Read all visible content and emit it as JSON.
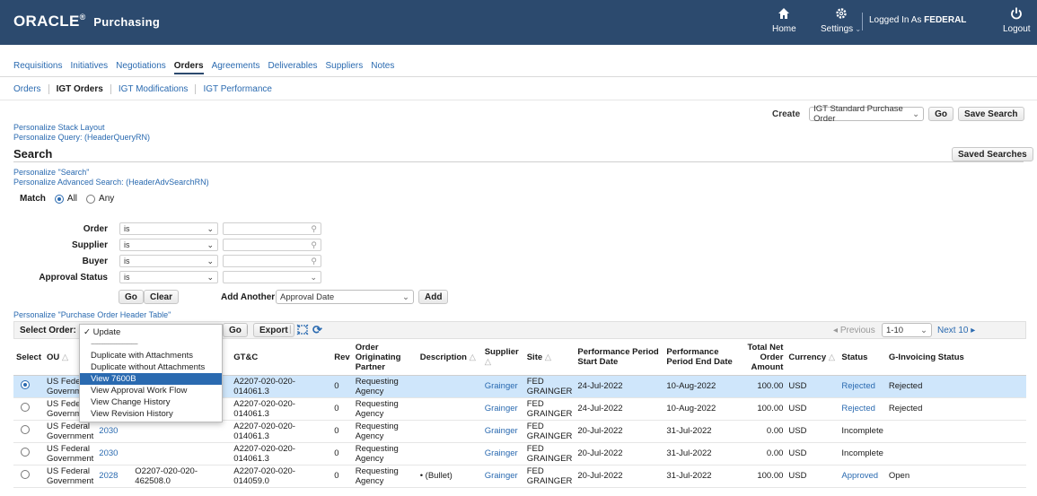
{
  "header": {
    "brand": "ORACLE",
    "app": "Purchasing",
    "home_label": "Home",
    "settings_label": "Settings",
    "logged_prefix": "Logged In As",
    "user": "FEDERAL",
    "logout_label": "Logout"
  },
  "tabs": [
    "Requisitions",
    "Initiatives",
    "Negotiations",
    "Orders",
    "Agreements",
    "Deliverables",
    "Suppliers",
    "Notes"
  ],
  "active_tab": "Orders",
  "subtabs": [
    "Orders",
    "IGT Orders",
    "IGT Modifications",
    "IGT Performance"
  ],
  "active_subtab": "IGT Orders",
  "create": {
    "label": "Create",
    "value": "IGT Standard Purchase Order",
    "go": "Go",
    "save_search": "Save Search"
  },
  "personalize": {
    "stack": "Personalize Stack Layout",
    "query": "Personalize Query: (HeaderQueryRN)",
    "search": "Personalize \"Search\"",
    "adv": "Personalize Advanced Search: (HeaderAdvSearchRN)",
    "table": "Personalize \"Purchase Order Header Table\""
  },
  "search": {
    "title": "Search",
    "saved_searches": "Saved Searches",
    "match_label": "Match",
    "match_all": "All",
    "match_any": "Any",
    "criteria": [
      {
        "label": "Order",
        "op": "is"
      },
      {
        "label": "Supplier",
        "op": "is"
      },
      {
        "label": "Buyer",
        "op": "is"
      },
      {
        "label": "Approval Status",
        "op": "is"
      }
    ],
    "go": "Go",
    "clear": "Clear",
    "add_another_label": "Add Another",
    "add_another_value": "Approval Date",
    "add": "Add"
  },
  "table_toolbar": {
    "select_order": "Select Order:",
    "go": "Go",
    "export": "Export",
    "previous": "Previous",
    "range": "1-10",
    "next": "Next 10"
  },
  "menu": {
    "items": [
      "Update",
      "------------------------",
      "Duplicate with Attachments",
      "Duplicate without Attachments",
      "View 7600B",
      "View Approval Work Flow",
      "View Change History",
      "View Revision History"
    ],
    "highlighted": "View 7600B"
  },
  "table": {
    "headers": {
      "select": "Select",
      "ou": "OU",
      "gtc": "GT&C",
      "rev": "Rev",
      "agency": "Order Originating Partner",
      "description": "Description",
      "supplier": "Supplier",
      "site": "Site",
      "start": "Performance Period Start Date",
      "end": "Performance Period End Date",
      "amount": "Total Net Order Amount",
      "currency": "Currency",
      "status": "Status",
      "ginv": "G-Invoicing Status"
    },
    "rows": [
      {
        "ou": "US Federal Government",
        "order": "",
        "ref": "",
        "gtc": "A2207-020-020-014061.3",
        "rev": "0",
        "agency": "Requesting Agency",
        "desc": "",
        "supplier": "Grainger",
        "site": "FED GRAINGER",
        "start": "24-Jul-2022",
        "end": "10-Aug-2022",
        "amount": "100.00",
        "currency": "USD",
        "status": "Rejected",
        "status_link": true,
        "ginv": "Rejected",
        "selected": true
      },
      {
        "ou": "US Federal Government",
        "order": "",
        "ref": "",
        "gtc": "A2207-020-020-014061.3",
        "rev": "0",
        "agency": "Requesting Agency",
        "desc": "",
        "supplier": "Grainger",
        "site": "FED GRAINGER",
        "start": "24-Jul-2022",
        "end": "10-Aug-2022",
        "amount": "100.00",
        "currency": "USD",
        "status": "Rejected",
        "status_link": true,
        "ginv": "Rejected",
        "selected": false
      },
      {
        "ou": "US Federal Government",
        "order": "2030",
        "ref": "",
        "gtc": "A2207-020-020-014061.3",
        "rev": "0",
        "agency": "Requesting Agency",
        "desc": "",
        "supplier": "Grainger",
        "site": "FED GRAINGER",
        "start": "20-Jul-2022",
        "end": "31-Jul-2022",
        "amount": "0.00",
        "currency": "USD",
        "status": "Incomplete",
        "status_link": false,
        "ginv": "",
        "selected": false
      },
      {
        "ou": "US Federal Government",
        "order": "2030",
        "ref": "",
        "gtc": "A2207-020-020-014061.3",
        "rev": "0",
        "agency": "Requesting Agency",
        "desc": "",
        "supplier": "Grainger",
        "site": "FED GRAINGER",
        "start": "20-Jul-2022",
        "end": "31-Jul-2022",
        "amount": "0.00",
        "currency": "USD",
        "status": "Incomplete",
        "status_link": false,
        "ginv": "",
        "selected": false
      },
      {
        "ou": "US Federal Government",
        "order": "2028",
        "ref": "O2207-020-020-462508.0",
        "gtc": "A2207-020-020-014059.0",
        "rev": "0",
        "agency": "Requesting Agency",
        "desc": "• (Bullet)",
        "supplier": "Grainger",
        "site": "FED GRAINGER",
        "start": "20-Jul-2022",
        "end": "31-Jul-2022",
        "amount": "100.00",
        "currency": "USD",
        "status": "Approved",
        "status_link": true,
        "ginv": "Open",
        "selected": false
      }
    ]
  },
  "colors": {
    "header_bg": "#2c4a6e",
    "link": "#2a6ab0",
    "selected_row": "#cfe6fb"
  }
}
